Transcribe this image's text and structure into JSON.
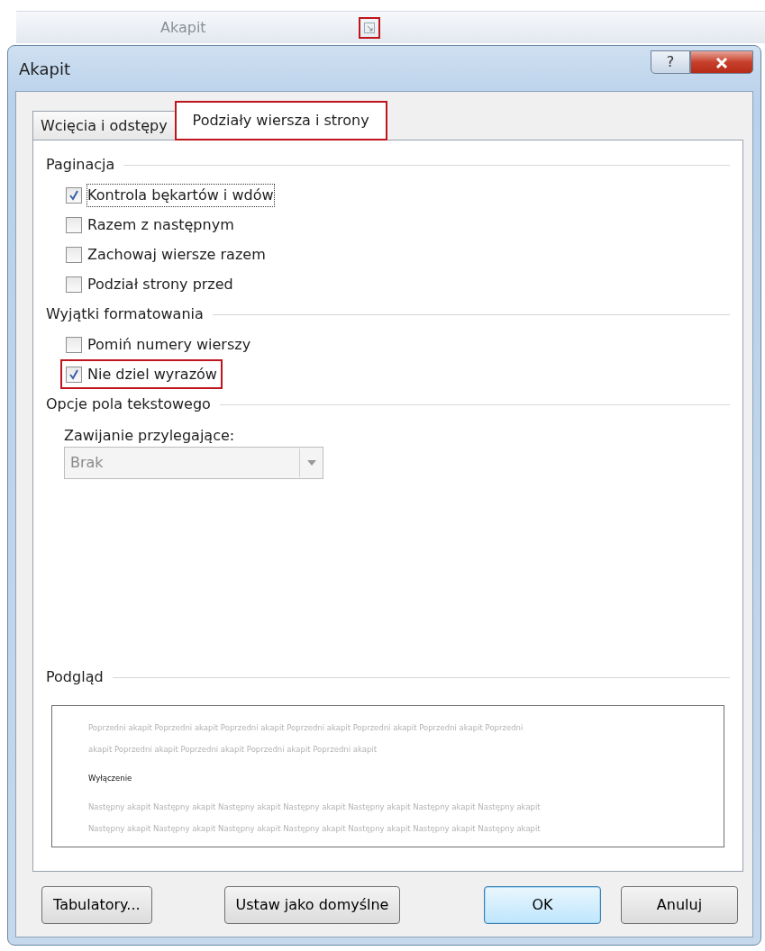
{
  "ribbon": {
    "group_label": "Akapit",
    "launcher_highlighted": true
  },
  "window": {
    "title": "Akapit",
    "help": "?"
  },
  "tabs": [
    {
      "label": "Wcięcia i odstępy",
      "selected": false,
      "highlighted": false
    },
    {
      "label": "Podziały wiersza i strony",
      "selected": true,
      "highlighted": true
    }
  ],
  "sections": [
    {
      "title": "Paginacja",
      "options": [
        {
          "label": "Kontrola bękartów i wdów",
          "checked": true,
          "focused": true,
          "highlighted": false
        },
        {
          "label": "Razem z następnym",
          "checked": false,
          "focused": false,
          "highlighted": false
        },
        {
          "label": "Zachowaj wiersze razem",
          "checked": false,
          "focused": false,
          "highlighted": false
        },
        {
          "label": "Podział strony przed",
          "checked": false,
          "focused": false,
          "highlighted": false
        }
      ]
    },
    {
      "title": "Wyjątki formatowania",
      "options": [
        {
          "label": "Pomiń numery wierszy",
          "checked": false,
          "focused": false,
          "highlighted": false
        },
        {
          "label": "Nie dziel wyrazów",
          "checked": true,
          "focused": false,
          "highlighted": true
        }
      ]
    },
    {
      "title": "Opcje pola tekstowego",
      "dropdown": {
        "label": "Zawijanie przylegające:",
        "value": "Brak",
        "disabled": true
      }
    }
  ],
  "preview": {
    "title": "Podgląd",
    "lines": [
      {
        "kind": "faint",
        "text": "Poprzedni akapit Poprzedni akapit Poprzedni akapit Poprzedni akapit Poprzedni akapit Poprzedni akapit Poprzedni"
      },
      {
        "kind": "faint",
        "text": "akapit Poprzedni akapit Poprzedni akapit Poprzedni akapit Poprzedni akapit"
      },
      {
        "kind": "sample",
        "text": "Wyłączenie"
      },
      {
        "kind": "faint",
        "text": "Następny akapit Następny akapit Następny akapit Następny akapit Następny akapit Następny akapit Następny akapit"
      },
      {
        "kind": "faint",
        "text": "Następny akapit Następny akapit Następny akapit Następny akapit Następny akapit Następny akapit Następny akapit"
      }
    ]
  },
  "buttons": [
    {
      "label": "Tabulatory...",
      "default": false
    },
    {
      "label": "Ustaw jako domyślne",
      "default": false
    },
    {
      "label": "OK",
      "default": true
    },
    {
      "label": "Anuluj",
      "default": false
    }
  ]
}
